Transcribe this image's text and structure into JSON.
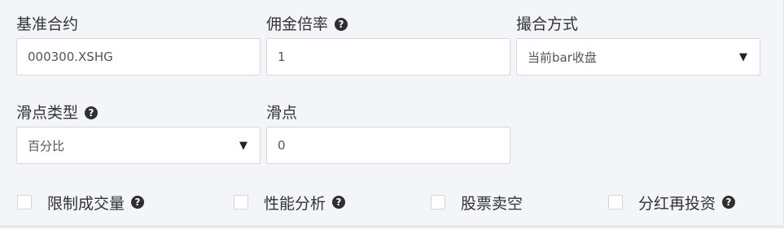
{
  "fields": {
    "benchmark": {
      "label": "基准合约",
      "value": "000300.XSHG"
    },
    "commission": {
      "label": "佣金倍率",
      "value": "1"
    },
    "matching": {
      "label": "撮合方式",
      "value": "当前bar收盘"
    },
    "slippage_type": {
      "label": "滑点类型",
      "value": "百分比"
    },
    "slippage": {
      "label": "滑点",
      "value": "0"
    }
  },
  "checkboxes": [
    {
      "label": "限制成交量",
      "checked": false,
      "help": true
    },
    {
      "label": "性能分析",
      "checked": false,
      "help": true
    },
    {
      "label": "股票卖空",
      "checked": false,
      "help": false
    },
    {
      "label": "分红再投资",
      "checked": false,
      "help": true
    }
  ],
  "icons": {
    "help": "question-circle-icon",
    "dropdown": "caret-down-icon"
  },
  "glyphs": {
    "help": "?",
    "caret": "▼"
  }
}
